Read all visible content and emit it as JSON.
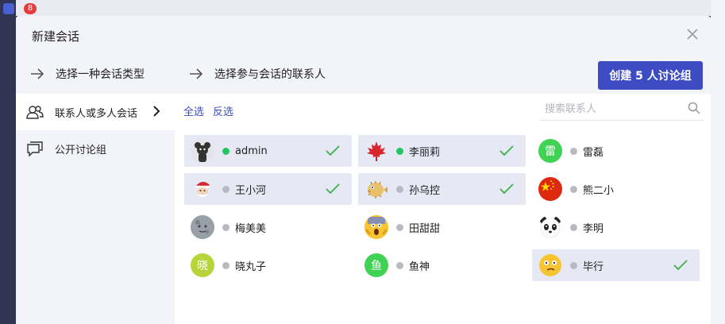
{
  "background": {
    "badge_count": "8"
  },
  "dialog": {
    "title": "新建会话",
    "steps": [
      "选择一种会话类型",
      "选择参与会话的联系人"
    ],
    "create_button": "创建 5 人讨论组"
  },
  "sidebar": {
    "items": [
      {
        "label": "联系人或多人会话",
        "icon": "contacts-icon"
      },
      {
        "label": "公开讨论组",
        "icon": "chat-bubbles-icon"
      }
    ]
  },
  "toolbar": {
    "select_all": "全选",
    "invert": "反选",
    "search_placeholder": "搜索联系人"
  },
  "contacts": [
    {
      "name": "admin",
      "avatar": "bear-icon",
      "online": true,
      "selected": true
    },
    {
      "name": "李丽莉",
      "avatar": "maple-leaf-icon",
      "online": true,
      "selected": true
    },
    {
      "name": "雷磊",
      "avatar_text": "雷",
      "avatar_color": "#3fd255",
      "online": false,
      "selected": false
    },
    {
      "name": "王小河",
      "avatar": "santa-icon",
      "online": false,
      "selected": true
    },
    {
      "name": "孙乌控",
      "avatar": "blowfish-icon",
      "online": false,
      "selected": true
    },
    {
      "name": "熊二小",
      "avatar": "china-flag-icon",
      "online": false,
      "selected": false
    },
    {
      "name": "梅美美",
      "avatar": "moon-face-icon",
      "online": false,
      "selected": false
    },
    {
      "name": "田甜甜",
      "avatar": "screaming-face-icon",
      "online": false,
      "selected": false
    },
    {
      "name": "李明",
      "avatar": "panda-icon",
      "online": false,
      "selected": false
    },
    {
      "name": "晓丸子",
      "avatar_text": "晓",
      "avatar_color": "#b7d53a",
      "online": false,
      "selected": false
    },
    {
      "name": "鱼神",
      "avatar_text": "鱼",
      "avatar_color": "#3fd255",
      "online": false,
      "selected": false
    },
    {
      "name": "毕行",
      "avatar": "thinking-face-icon",
      "online": false,
      "selected": true
    }
  ],
  "colors": {
    "accent": "#3d4cc2",
    "online": "#1ec761",
    "offline": "#b8bac2",
    "check": "#3dae4b",
    "selected_bg": "#e6e8f4"
  }
}
